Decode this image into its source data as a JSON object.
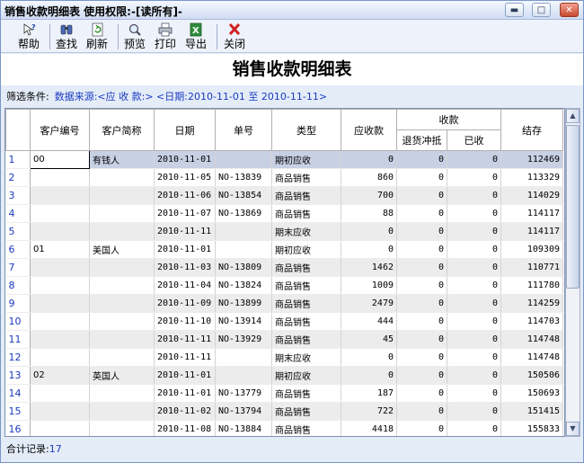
{
  "window": {
    "title": "销售收款明细表 使用权限:-[读所有]-"
  },
  "toolbar": [
    {
      "name": "help-button",
      "icon": "help-icon",
      "label": "帮助"
    },
    {
      "name": "find-button",
      "icon": "binoculars-icon",
      "label": "查找"
    },
    {
      "name": "refresh-button",
      "icon": "refresh-icon",
      "label": "刷新"
    },
    {
      "name": "preview-button",
      "icon": "magnifier-icon",
      "label": "预览"
    },
    {
      "name": "print-button",
      "icon": "printer-icon",
      "label": "打印"
    },
    {
      "name": "export-button",
      "icon": "excel-icon",
      "label": "导出"
    },
    {
      "name": "close-button",
      "icon": "red-x-icon",
      "label": "关闭"
    }
  ],
  "heading": "销售收款明细表",
  "filter": {
    "label": "筛选条件:",
    "value": "数据来源:<应 收 款:> <日期:2010-11-01 至 2010-11-11>"
  },
  "table": {
    "headers": {
      "customer_code": "客户编号",
      "customer_name": "客户简称",
      "date": "日期",
      "doc_no": "单号",
      "type": "类型",
      "receivable": "应收款",
      "received_group": "收款",
      "return_offset": "退货冲抵",
      "received": "已收",
      "balance": "结存"
    },
    "rows": [
      {
        "rn": "1",
        "code": "00",
        "name": "有钱人",
        "date": "2010-11-01",
        "doc": "",
        "type": "期初应收",
        "recv": "0",
        "ret": "0",
        "got": "0",
        "bal": "112469"
      },
      {
        "rn": "2",
        "code": "",
        "name": "",
        "date": "2010-11-05",
        "doc": "NO-13839",
        "type": "商品销售",
        "recv": "860",
        "ret": "0",
        "got": "0",
        "bal": "113329"
      },
      {
        "rn": "3",
        "code": "",
        "name": "",
        "date": "2010-11-06",
        "doc": "NO-13854",
        "type": "商品销售",
        "recv": "700",
        "ret": "0",
        "got": "0",
        "bal": "114029"
      },
      {
        "rn": "4",
        "code": "",
        "name": "",
        "date": "2010-11-07",
        "doc": "NO-13869",
        "type": "商品销售",
        "recv": "88",
        "ret": "0",
        "got": "0",
        "bal": "114117"
      },
      {
        "rn": "5",
        "code": "",
        "name": "",
        "date": "2010-11-11",
        "doc": "",
        "type": "期末应收",
        "recv": "0",
        "ret": "0",
        "got": "0",
        "bal": "114117"
      },
      {
        "rn": "6",
        "code": "01",
        "name": "美国人",
        "date": "2010-11-01",
        "doc": "",
        "type": "期初应收",
        "recv": "0",
        "ret": "0",
        "got": "0",
        "bal": "109309"
      },
      {
        "rn": "7",
        "code": "",
        "name": "",
        "date": "2010-11-03",
        "doc": "NO-13809",
        "type": "商品销售",
        "recv": "1462",
        "ret": "0",
        "got": "0",
        "bal": "110771"
      },
      {
        "rn": "8",
        "code": "",
        "name": "",
        "date": "2010-11-04",
        "doc": "NO-13824",
        "type": "商品销售",
        "recv": "1009",
        "ret": "0",
        "got": "0",
        "bal": "111780"
      },
      {
        "rn": "9",
        "code": "",
        "name": "",
        "date": "2010-11-09",
        "doc": "NO-13899",
        "type": "商品销售",
        "recv": "2479",
        "ret": "0",
        "got": "0",
        "bal": "114259"
      },
      {
        "rn": "10",
        "code": "",
        "name": "",
        "date": "2010-11-10",
        "doc": "NO-13914",
        "type": "商品销售",
        "recv": "444",
        "ret": "0",
        "got": "0",
        "bal": "114703"
      },
      {
        "rn": "11",
        "code": "",
        "name": "",
        "date": "2010-11-11",
        "doc": "NO-13929",
        "type": "商品销售",
        "recv": "45",
        "ret": "0",
        "got": "0",
        "bal": "114748"
      },
      {
        "rn": "12",
        "code": "",
        "name": "",
        "date": "2010-11-11",
        "doc": "",
        "type": "期末应收",
        "recv": "0",
        "ret": "0",
        "got": "0",
        "bal": "114748"
      },
      {
        "rn": "13",
        "code": "02",
        "name": "英国人",
        "date": "2010-11-01",
        "doc": "",
        "type": "期初应收",
        "recv": "0",
        "ret": "0",
        "got": "0",
        "bal": "150506"
      },
      {
        "rn": "14",
        "code": "",
        "name": "",
        "date": "2010-11-01",
        "doc": "NO-13779",
        "type": "商品销售",
        "recv": "187",
        "ret": "0",
        "got": "0",
        "bal": "150693"
      },
      {
        "rn": "15",
        "code": "",
        "name": "",
        "date": "2010-11-02",
        "doc": "NO-13794",
        "type": "商品销售",
        "recv": "722",
        "ret": "0",
        "got": "0",
        "bal": "151415"
      },
      {
        "rn": "16",
        "code": "",
        "name": "",
        "date": "2010-11-08",
        "doc": "NO-13884",
        "type": "商品销售",
        "recv": "4418",
        "ret": "0",
        "got": "0",
        "bal": "155833"
      }
    ]
  },
  "status": {
    "label": "合计记录:",
    "count": "17"
  }
}
